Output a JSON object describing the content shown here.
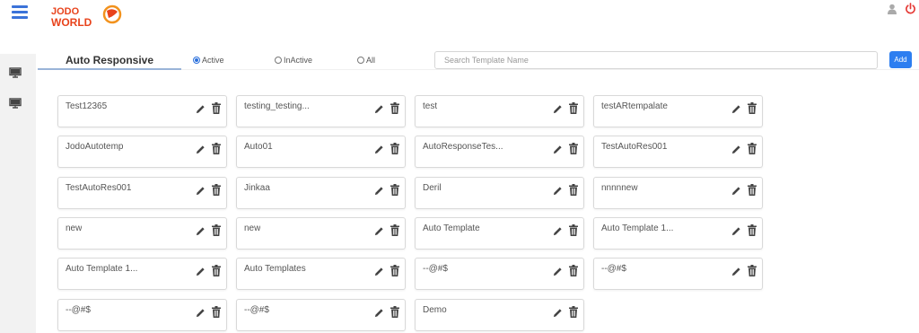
{
  "header": {
    "menu_icon": "hamburger-icon",
    "logo_text_top": "JODO",
    "logo_text_bottom": "WORLD",
    "brand_colors": [
      "#e8431c",
      "#f2921d"
    ],
    "user_icon": "user-icon",
    "power_icon": "power-icon"
  },
  "sidebar": {
    "items": [
      {
        "icon": "monitor-icon"
      },
      {
        "icon": "monitor-icon"
      }
    ]
  },
  "tabs": {
    "active_label": "Auto Responsive"
  },
  "filters": {
    "options": [
      {
        "label": "Active",
        "selected": true
      },
      {
        "label": "InActive",
        "selected": false
      },
      {
        "label": "All",
        "selected": false
      }
    ]
  },
  "search": {
    "placeholder": "Search Template Name",
    "value": ""
  },
  "add_button": {
    "label": "Add",
    "color": "#2d7ef0"
  },
  "templates": [
    "Test12365",
    "testing_testing...",
    "test",
    "testARtempalate",
    "JodoAutotemp",
    "Auto01",
    "AutoResponseTes...",
    "TestAutoRes001",
    "TestAutoRes001",
    "Jinkaa",
    "Deril",
    "nnnnnew",
    "new",
    "new",
    "Auto Template",
    "Auto Template 1...",
    "Auto Template 1...",
    "Auto Templates",
    "--@#$",
    "--@#$",
    "--@#$",
    "--@#$",
    "Demo"
  ]
}
